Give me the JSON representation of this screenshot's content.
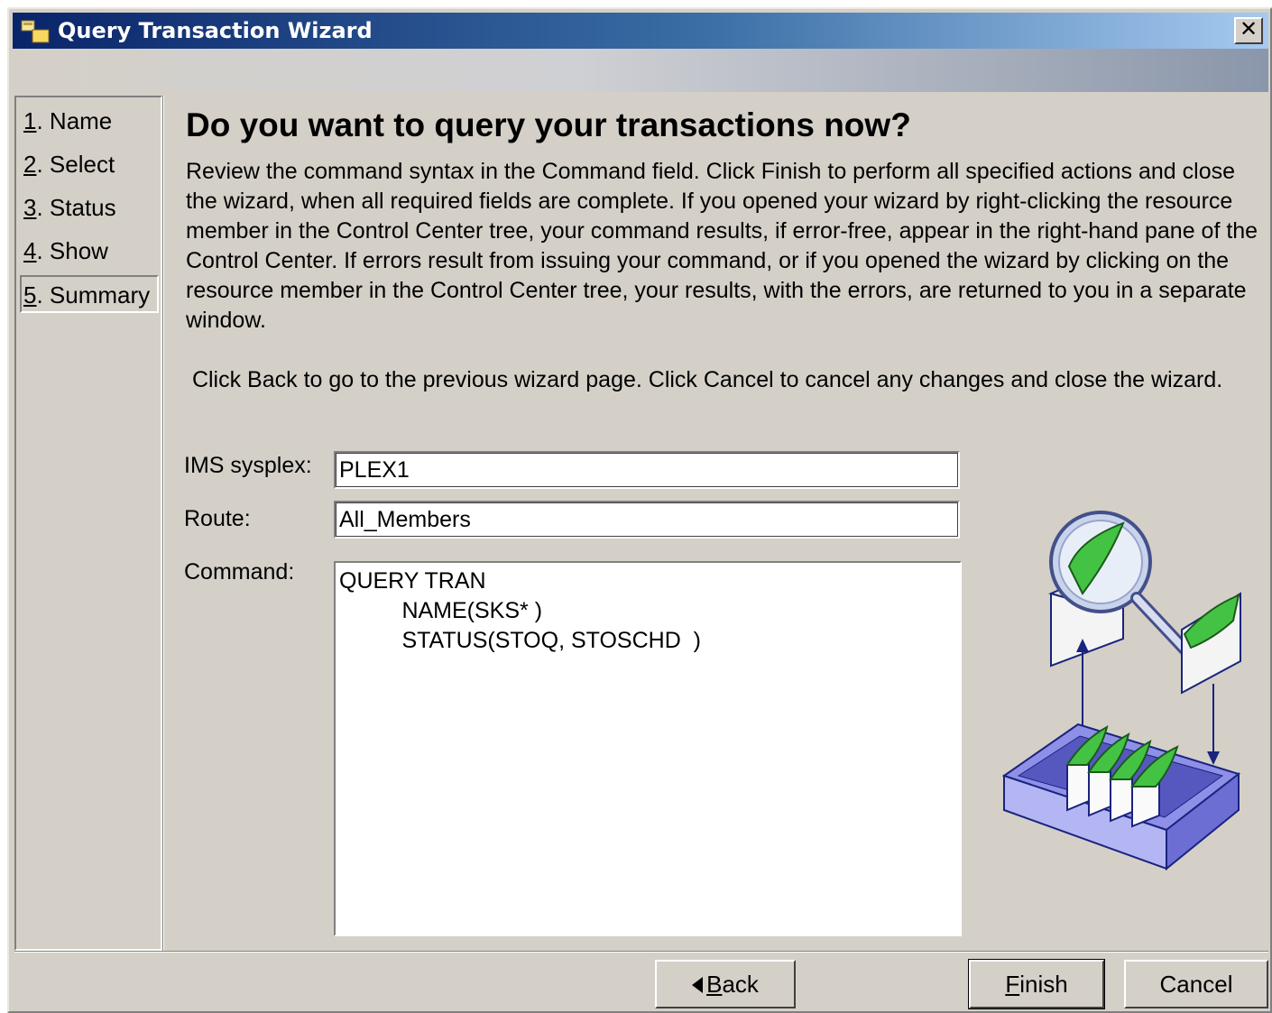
{
  "window": {
    "title": "Query Transaction Wizard",
    "close_label": "✕"
  },
  "steps": [
    {
      "num": "1",
      "label": ". Name"
    },
    {
      "num": "2",
      "label": ". Select"
    },
    {
      "num": "3",
      "label": ". Status"
    },
    {
      "num": "4",
      "label": ". Show"
    },
    {
      "num": "5",
      "label": ". Summary"
    }
  ],
  "current_step": 5,
  "main": {
    "heading": "Do you want to query your transactions now?",
    "paragraph1": "Review the command syntax in the Command field. Click Finish to perform all specified actions and close the wizard, when all required fields are complete. If you opened your wizard by right-clicking the resource member in the Control Center tree, your command results, if error-free, appear in the right-hand pane of the Control Center. If errors result from issuing your command, or if you opened the wizard by clicking on the resource member in the Control Center tree, your results, with the errors, are returned to you in a separate window.",
    "paragraph2": " Click Back to go to the previous wizard page. Click Cancel to cancel any changes and close the wizard."
  },
  "form": {
    "sysplex_label": "IMS sysplex:",
    "sysplex_value": "PLEX1",
    "route_label": "Route:",
    "route_value": "All_Members",
    "command_label": "Command:",
    "command_lines": [
      "QUERY TRAN",
      "          NAME(SKS* )",
      "          STATUS(STOQ, STOSCHD  )"
    ]
  },
  "buttons": {
    "back_mnemonic": "B",
    "back_rest": "ack",
    "finish_mnemonic": "F",
    "finish_rest": "inish",
    "cancel": "Cancel"
  },
  "icons": {
    "title": "wizard-app-icon",
    "illustration": "envelopes-tray-magnifier-illustration"
  },
  "colors": {
    "title_start": "#0a246a",
    "title_end": "#a6caf0",
    "face": "#d4d0c8",
    "envelope_flap": "#44c244",
    "tray": "#9a9cf0"
  }
}
